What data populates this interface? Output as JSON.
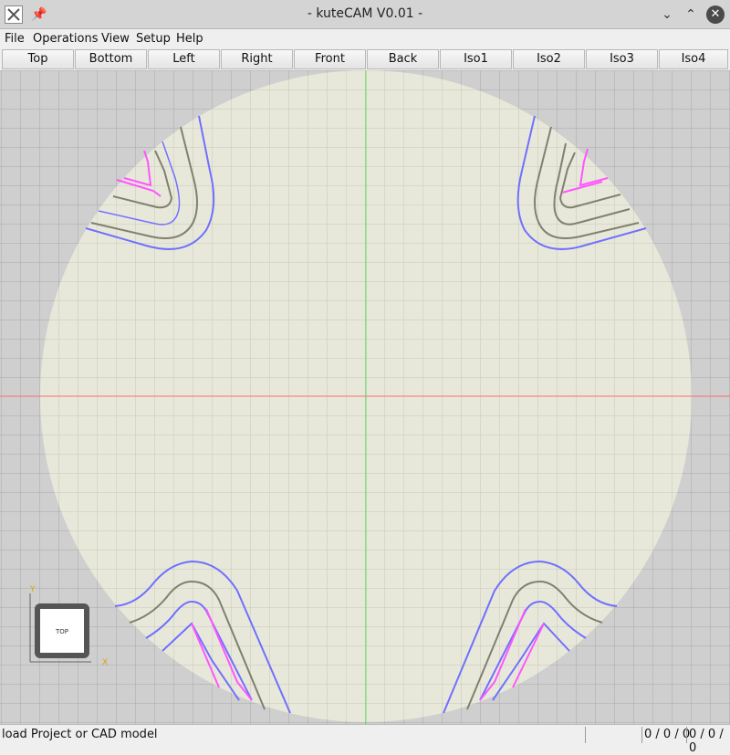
{
  "window": {
    "title": "- kuteCAM V0.01 -"
  },
  "menu": [
    "File",
    "Operations",
    "View",
    "Setup",
    "Help"
  ],
  "view_buttons": [
    "Top",
    "Bottom",
    "Left",
    "Right",
    "Front",
    "Back",
    "Iso1",
    "Iso2",
    "Iso3",
    "Iso4"
  ],
  "navcube": {
    "face": "TOP",
    "axis_y": "Y",
    "axis_x": "X"
  },
  "status": {
    "message": "load Project or CAD model",
    "coords_a": "0 / 0 / 0",
    "coords_b": "0 / 0 / 0"
  },
  "colors": {
    "stock": "#e8e8da",
    "grid": "#a9a9a9",
    "x_axis": "#ff6b6b",
    "y_axis": "#66e066",
    "outer_path": "#7070ff",
    "mid_path": "#808070",
    "inner_path": "#ff55ff"
  }
}
